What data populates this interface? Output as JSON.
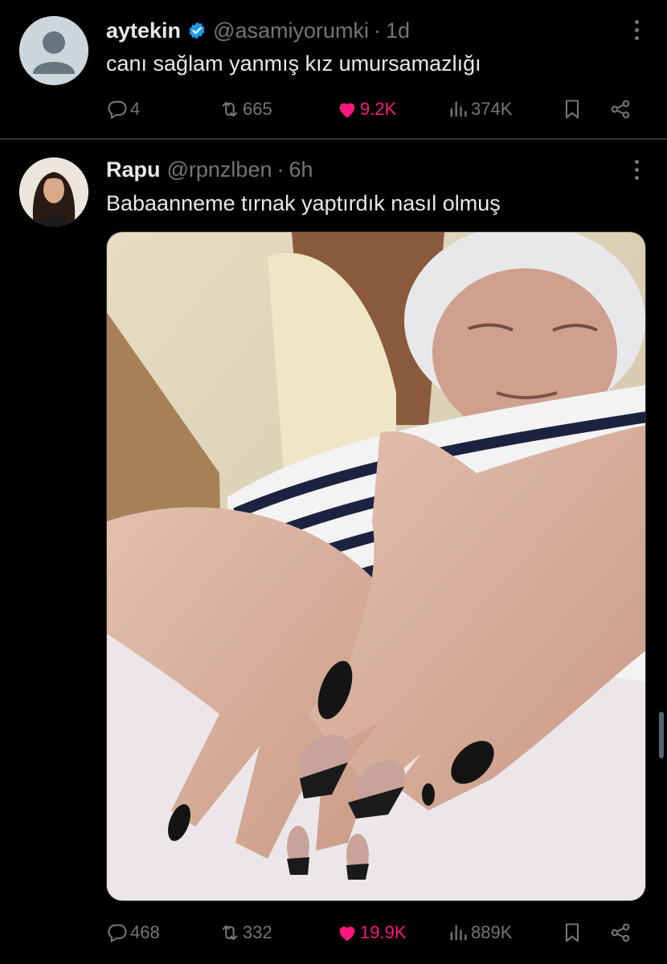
{
  "tweets": [
    {
      "name": "aytekin",
      "verified": true,
      "handle": "@asamiyorumki",
      "time": "1d",
      "text": "canı sağlam yanmış kız umursamazlığı",
      "replies": "4",
      "retweets": "665",
      "likes": "9.2K",
      "views": "374K",
      "avatar_icon": "default-profile-icon"
    },
    {
      "name": "Rapu",
      "verified": false,
      "handle": "@rpnzlben",
      "time": "6h",
      "text": "Babaanneme tırnak yaptırdık nasıl olmuş",
      "replies": "468",
      "retweets": "332",
      "likes": "19.9K",
      "views": "889K",
      "avatar_icon": "profile-photo"
    }
  ],
  "separator": "·",
  "colors": {
    "background": "#000000",
    "text": "#e7e9ea",
    "muted": "#71767b",
    "like": "#f91880",
    "verified": "#1d9bf0",
    "divider": "#2f3336"
  }
}
